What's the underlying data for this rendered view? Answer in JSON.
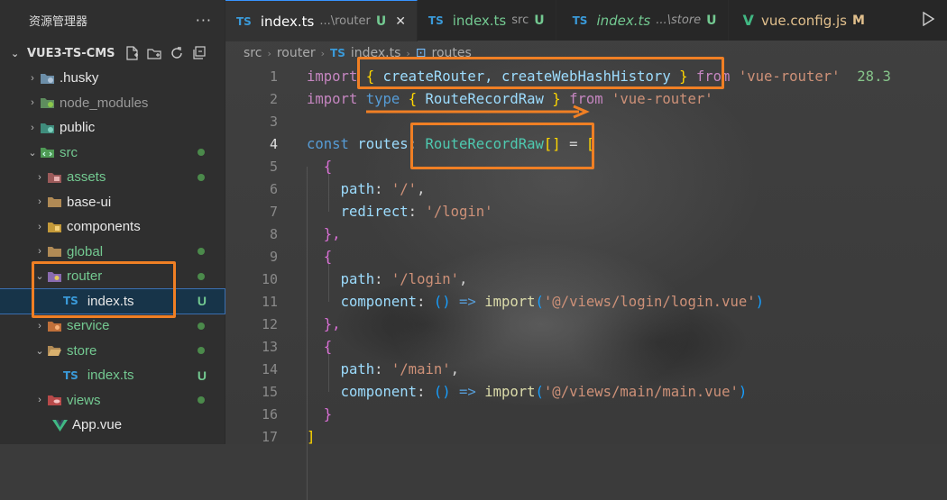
{
  "sidebar": {
    "title": "资源管理器",
    "more": "···",
    "project": "VUE3-TS-CMS",
    "items": [
      {
        "label": ".husky",
        "chevron": "›"
      },
      {
        "label": "node_modules",
        "chevron": "›"
      },
      {
        "label": "public",
        "chevron": "›"
      },
      {
        "label": "src",
        "chevron": "⌄"
      },
      {
        "label": "assets",
        "chevron": "›"
      },
      {
        "label": "base-ui",
        "chevron": "›"
      },
      {
        "label": "components",
        "chevron": "›"
      },
      {
        "label": "global",
        "chevron": "›"
      },
      {
        "label": "router",
        "chevron": "⌄"
      },
      {
        "label": "index.ts",
        "badge": "U",
        "type": "TS"
      },
      {
        "label": "service",
        "chevron": "›"
      },
      {
        "label": "store",
        "chevron": "⌄"
      },
      {
        "label": "index.ts",
        "badge": "U",
        "type": "TS"
      },
      {
        "label": "views",
        "chevron": "›"
      },
      {
        "label": "App.vue"
      }
    ]
  },
  "tabs": [
    {
      "type": "TS",
      "name": "index.ts",
      "dir": "...\\router",
      "status": "U",
      "close": "✕"
    },
    {
      "type": "TS",
      "name": "index.ts",
      "dir": "src",
      "status": "U"
    },
    {
      "type": "TS",
      "name": "index.ts",
      "dir": "...\\store",
      "status": "U"
    },
    {
      "type": "V",
      "name": "vue.config.js",
      "status": "M"
    }
  ],
  "breadcrumb": {
    "p1": "src",
    "p2": "router",
    "file_type": "TS",
    "file": "index.ts",
    "symbol": "routes"
  },
  "code": {
    "line_numbers": [
      "1",
      "2",
      "3",
      "4",
      "5",
      "6",
      "7",
      "8",
      "9",
      "10",
      "11",
      "12",
      "13",
      "14",
      "15",
      "16",
      "17"
    ],
    "l1": {
      "kw": "import",
      "b1": "{",
      "text": " createRouter, createWebHashHistory ",
      "b2": "}",
      "from": "from",
      "src": "'vue-router'",
      "size": "28.3"
    },
    "l2": {
      "kw": "import",
      "type": "type",
      "b1": "{",
      "name": " RouteRecordRaw ",
      "b2": "}",
      "from": "from",
      "src": "'vue-router'"
    },
    "l4": {
      "kw": "const",
      "name": "routes",
      "colon": ": ",
      "type": "RouteRecordRaw",
      "arr": "[]",
      "eq": " = ",
      "open": "["
    },
    "l5": "{",
    "l6": {
      "key": "path",
      "val": "'/'"
    },
    "l7": {
      "key": "redirect",
      "val": "'/login'"
    },
    "l8": "},",
    "l9": "{",
    "l10": {
      "key": "path",
      "val": "'/login'"
    },
    "l11": {
      "key": "component",
      "fn": "import",
      "path": "'@/views/login/login.vue'"
    },
    "l12": "},",
    "l13": "{",
    "l14": {
      "key": "path",
      "val": "'/main'"
    },
    "l15": {
      "key": "component",
      "fn": "import",
      "path": "'@/views/main/main.vue'"
    },
    "l16": "}",
    "l17": "]"
  },
  "colors": {
    "accent_annotation": "#f07f24",
    "tab_active_border": "#3794ff",
    "git_untracked": "#73c991"
  }
}
